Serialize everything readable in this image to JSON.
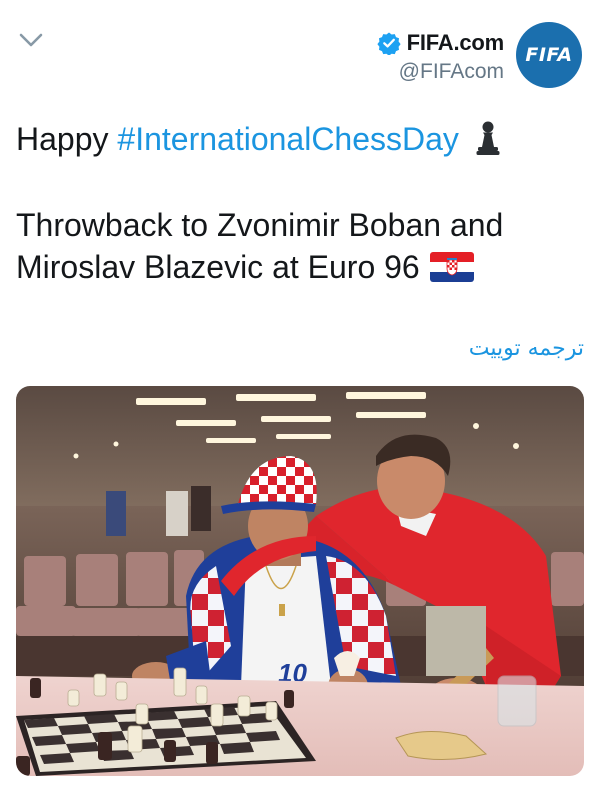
{
  "header": {
    "display_name": "FIFA.com",
    "handle": "@FIFAcom",
    "avatar_text": "FIFA"
  },
  "tweet": {
    "text_prefix": "Happy ",
    "hashtag": "#InternationalChessDay",
    "line2": "Throwback to Zvonimir Boban and",
    "line3": "Miroslav Blazevic at Euro 96"
  },
  "translate_label": "ترجمه توییت",
  "icons": {
    "collapse": "chevron-down-icon",
    "verified": "verified-badge-icon",
    "pawn": "chess-pawn-emoji",
    "flag": "croatia-flag-emoji"
  },
  "colors": {
    "link": "#1b95e0",
    "text": "#14171a",
    "secondary": "#657786",
    "avatar_bg": "#1b6fae",
    "verified": "#1da1f2"
  }
}
